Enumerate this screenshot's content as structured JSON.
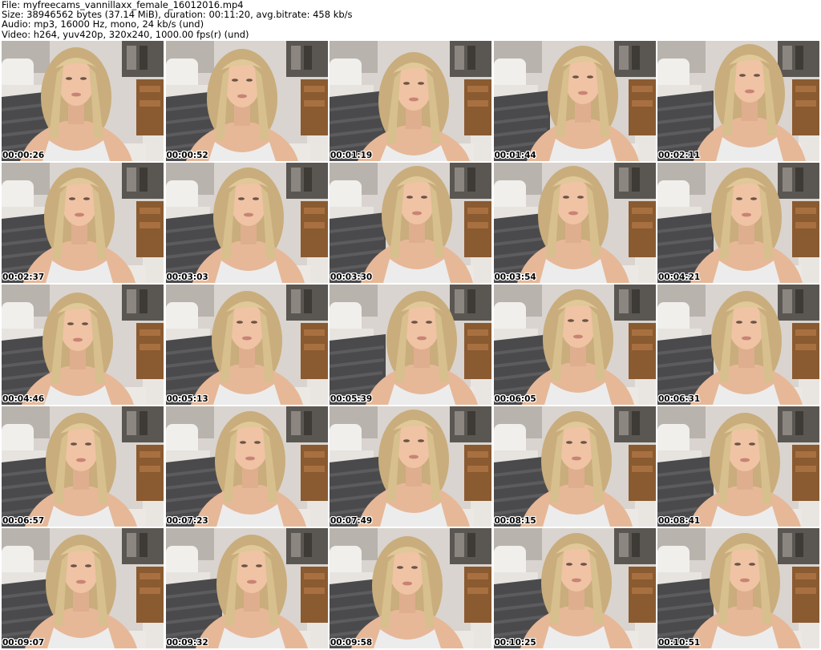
{
  "header": {
    "file_line": "File: myfreecams_vannillaxx_female_16012016.mp4",
    "size_line": "Size: 38946562 bytes (37.14 MiB), duration: 00:11:20, avg.bitrate: 458 kb/s",
    "audio_line": "Audio: mp3, 16000 Hz, mono, 24 kb/s (und)",
    "video_line": "Video: h264, yuv420p, 320x240, 1000.00 fps(r) (und)"
  },
  "thumbnails": [
    {
      "timestamp": "00:00:26"
    },
    {
      "timestamp": "00:00:52"
    },
    {
      "timestamp": "00:01:19"
    },
    {
      "timestamp": "00:01:44"
    },
    {
      "timestamp": "00:02:11"
    },
    {
      "timestamp": "00:02:37"
    },
    {
      "timestamp": "00:03:03"
    },
    {
      "timestamp": "00:03:30"
    },
    {
      "timestamp": "00:03:54"
    },
    {
      "timestamp": "00:04:21"
    },
    {
      "timestamp": "00:04:46"
    },
    {
      "timestamp": "00:05:13"
    },
    {
      "timestamp": "00:05:39"
    },
    {
      "timestamp": "00:06:05"
    },
    {
      "timestamp": "00:06:31"
    },
    {
      "timestamp": "00:06:57"
    },
    {
      "timestamp": "00:07:23"
    },
    {
      "timestamp": "00:07:49"
    },
    {
      "timestamp": "00:08:15"
    },
    {
      "timestamp": "00:08:41"
    },
    {
      "timestamp": "00:09:07"
    },
    {
      "timestamp": "00:09:32"
    },
    {
      "timestamp": "00:09:58"
    },
    {
      "timestamp": "00:10:25"
    },
    {
      "timestamp": "00:10:51"
    }
  ]
}
